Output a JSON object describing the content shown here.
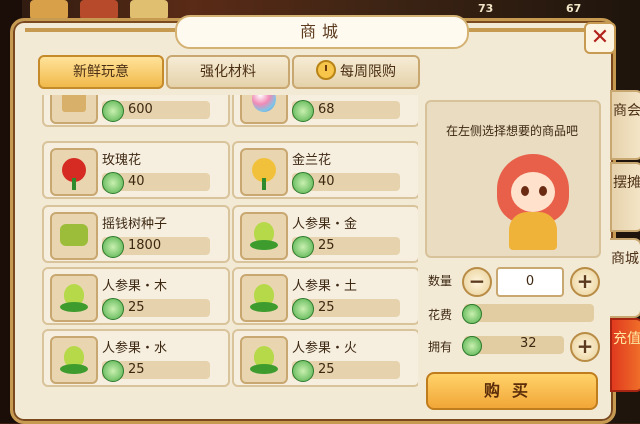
{
  "background": {
    "counters": [
      "73",
      "67"
    ]
  },
  "window": {
    "title": "商城",
    "close_label": "✕"
  },
  "tabs": [
    {
      "label": "新鲜玩意",
      "active": true
    },
    {
      "label": "强化材料",
      "active": false
    },
    {
      "label": "每周限购",
      "active": false,
      "icon": "clock-icon"
    }
  ],
  "items": [
    {
      "name": "",
      "price": "600",
      "icon": "scroll-icon"
    },
    {
      "name": "",
      "price": "68",
      "icon": "gem-fruit-icon"
    },
    {
      "name": "玫瑰花",
      "price": "40",
      "icon": "rose-icon"
    },
    {
      "name": "金兰花",
      "price": "40",
      "icon": "yellow-flower-icon"
    },
    {
      "name": "摇钱树种子",
      "price": "1800",
      "icon": "seed-icon"
    },
    {
      "name": "人参果・金",
      "price": "25",
      "icon": "ginseng-fruit-icon"
    },
    {
      "name": "人参果・木",
      "price": "25",
      "icon": "ginseng-fruit-icon"
    },
    {
      "name": "人参果・土",
      "price": "25",
      "icon": "ginseng-fruit-icon"
    },
    {
      "name": "人参果・水",
      "price": "25",
      "icon": "ginseng-fruit-icon"
    },
    {
      "name": "人参果・火",
      "price": "25",
      "icon": "ginseng-fruit-icon"
    }
  ],
  "detail": {
    "hint": "在左侧选择想要的商品吧"
  },
  "purchase": {
    "quantity_label": "数量",
    "quantity_value": "0",
    "minus": "−",
    "plus": "+",
    "cost_label": "花费",
    "owned_label": "拥有",
    "owned_value": "32",
    "buy_label": "购买"
  },
  "side_tabs": [
    {
      "label": "商会"
    },
    {
      "label": "摆摊"
    },
    {
      "label": "商城"
    },
    {
      "label": "充值"
    }
  ],
  "colors": {
    "accent": "#f2a637",
    "panel": "#f3ead6",
    "coin": "#4fae4a",
    "recharge": "#e03a1e"
  }
}
